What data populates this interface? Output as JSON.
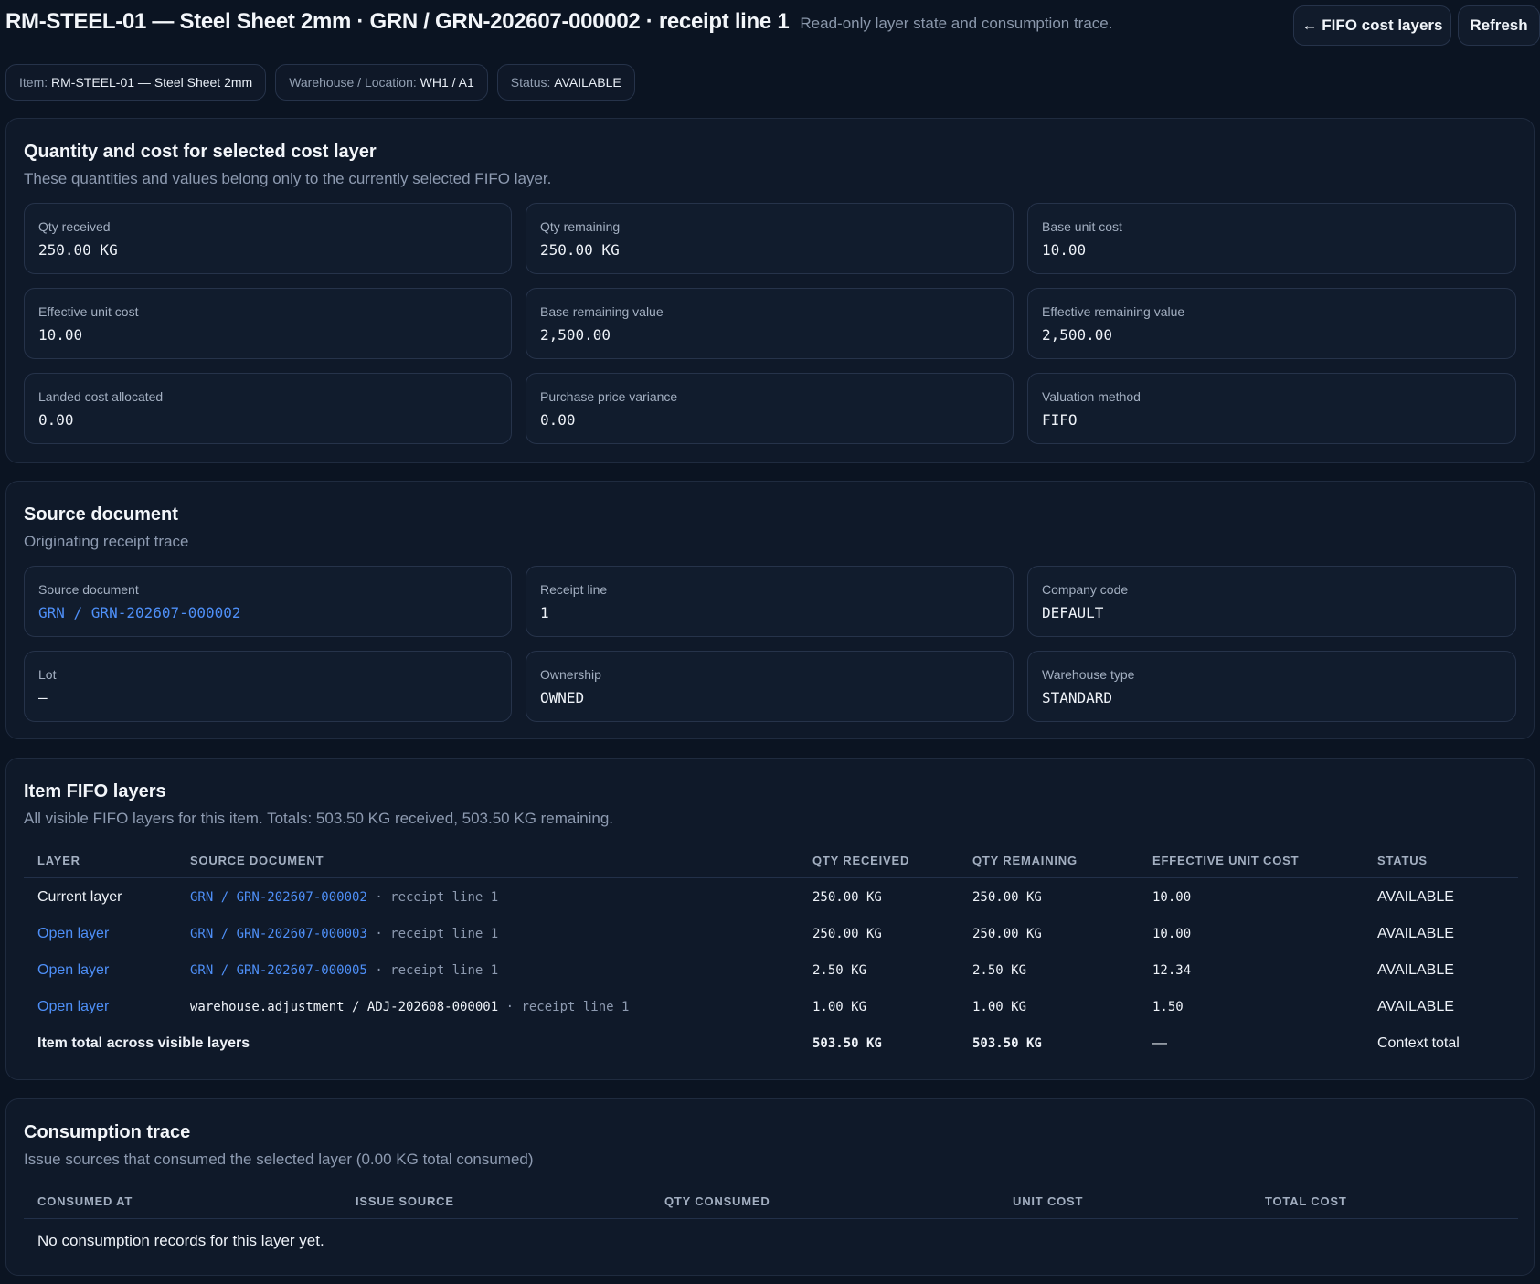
{
  "header": {
    "title": "RM-STEEL-01 — Steel Sheet 2mm · GRN / GRN-202607-000002 · receipt line 1",
    "subtitle": "Read-only layer state and consumption trace.",
    "back_label": "← FIFO cost layers",
    "refresh_label": "Refresh"
  },
  "chips": {
    "item_label": "Item:",
    "item_value": "RM-STEEL-01 — Steel Sheet 2mm",
    "location_label": "Warehouse / Location:",
    "location_value": "WH1 / A1",
    "status_label": "Status:",
    "status_value": "AVAILABLE"
  },
  "qty_cost": {
    "title": "Quantity and cost for selected cost layer",
    "description": "These quantities and values belong only to the currently selected FIFO layer.",
    "cards": [
      {
        "label": "Qty received",
        "value": "250.00 KG"
      },
      {
        "label": "Qty remaining",
        "value": "250.00 KG"
      },
      {
        "label": "Base unit cost",
        "value": "10.00"
      },
      {
        "label": "Effective unit cost",
        "value": "10.00"
      },
      {
        "label": "Base remaining value",
        "value": "2,500.00"
      },
      {
        "label": "Effective remaining value",
        "value": "2,500.00"
      },
      {
        "label": "Landed cost allocated",
        "value": "0.00"
      },
      {
        "label": "Purchase price variance",
        "value": "0.00"
      },
      {
        "label": "Valuation method",
        "value": "FIFO"
      }
    ]
  },
  "source": {
    "title": "Source document",
    "description": "Originating receipt trace",
    "cards": [
      {
        "label": "Source document",
        "value": "GRN / GRN-202607-000002"
      },
      {
        "label": "Receipt line",
        "value": "1"
      },
      {
        "label": "Company code",
        "value": "DEFAULT"
      },
      {
        "label": "Lot",
        "value": "—"
      },
      {
        "label": "Ownership",
        "value": "OWNED"
      },
      {
        "label": "Warehouse type",
        "value": "STANDARD"
      }
    ]
  },
  "layers": {
    "title": "Item FIFO layers",
    "description": "All visible FIFO layers for this item. Totals: 503.50 KG received, 503.50 KG remaining.",
    "columns": [
      "LAYER",
      "SOURCE DOCUMENT",
      "QTY RECEIVED",
      "QTY REMAINING",
      "EFFECTIVE UNIT COST",
      "STATUS"
    ],
    "rows": [
      {
        "layer": "Current layer",
        "doc": "GRN / GRN-202607-000002",
        "line": "· receipt line 1",
        "qty_received": "250.00 KG",
        "qty_remaining": "250.00 KG",
        "unit_cost": "10.00",
        "status": "AVAILABLE"
      },
      {
        "layer": "Open layer",
        "doc": "GRN / GRN-202607-000003",
        "line": "· receipt line 1",
        "qty_received": "250.00 KG",
        "qty_remaining": "250.00 KG",
        "unit_cost": "10.00",
        "status": "AVAILABLE"
      },
      {
        "layer": "Open layer",
        "doc": "GRN / GRN-202607-000005",
        "line": "· receipt line 1",
        "qty_received": "2.50 KG",
        "qty_remaining": "2.50 KG",
        "unit_cost": "12.34",
        "status": "AVAILABLE"
      },
      {
        "layer": "Open layer",
        "doc": "warehouse.adjustment / ADJ-202608-000001",
        "line": "· receipt line 1",
        "qty_received": "1.00 KG",
        "qty_remaining": "1.00 KG",
        "unit_cost": "1.50",
        "status": "AVAILABLE"
      }
    ],
    "total": {
      "label": "Item total across visible layers",
      "qty_received": "503.50 KG",
      "qty_remaining": "503.50 KG",
      "unit_cost": "—",
      "status": "Context total"
    }
  },
  "consumption": {
    "title": "Consumption trace",
    "description": "Issue sources that consumed the selected layer (0.00 KG total consumed)",
    "columns": [
      "CONSUMED AT",
      "ISSUE SOURCE",
      "QTY CONSUMED",
      "UNIT COST",
      "TOTAL COST"
    ],
    "empty": "No consumption records for this layer yet."
  }
}
